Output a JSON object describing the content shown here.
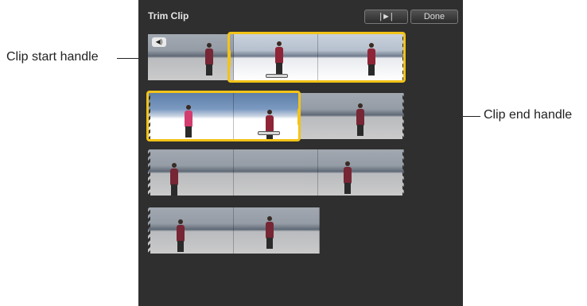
{
  "window": {
    "title": "Trim Clip",
    "play_label": "|►|",
    "done_label": "Done"
  },
  "icons": {
    "speaker": "speaker-icon",
    "play_selection": "play-selection-icon"
  },
  "speaker_glyph": "◀)",
  "callouts": {
    "start": "Clip start handle",
    "end": "Clip end handle"
  },
  "colors": {
    "selection": "#f3c318",
    "panel": "#2f2f2f"
  }
}
